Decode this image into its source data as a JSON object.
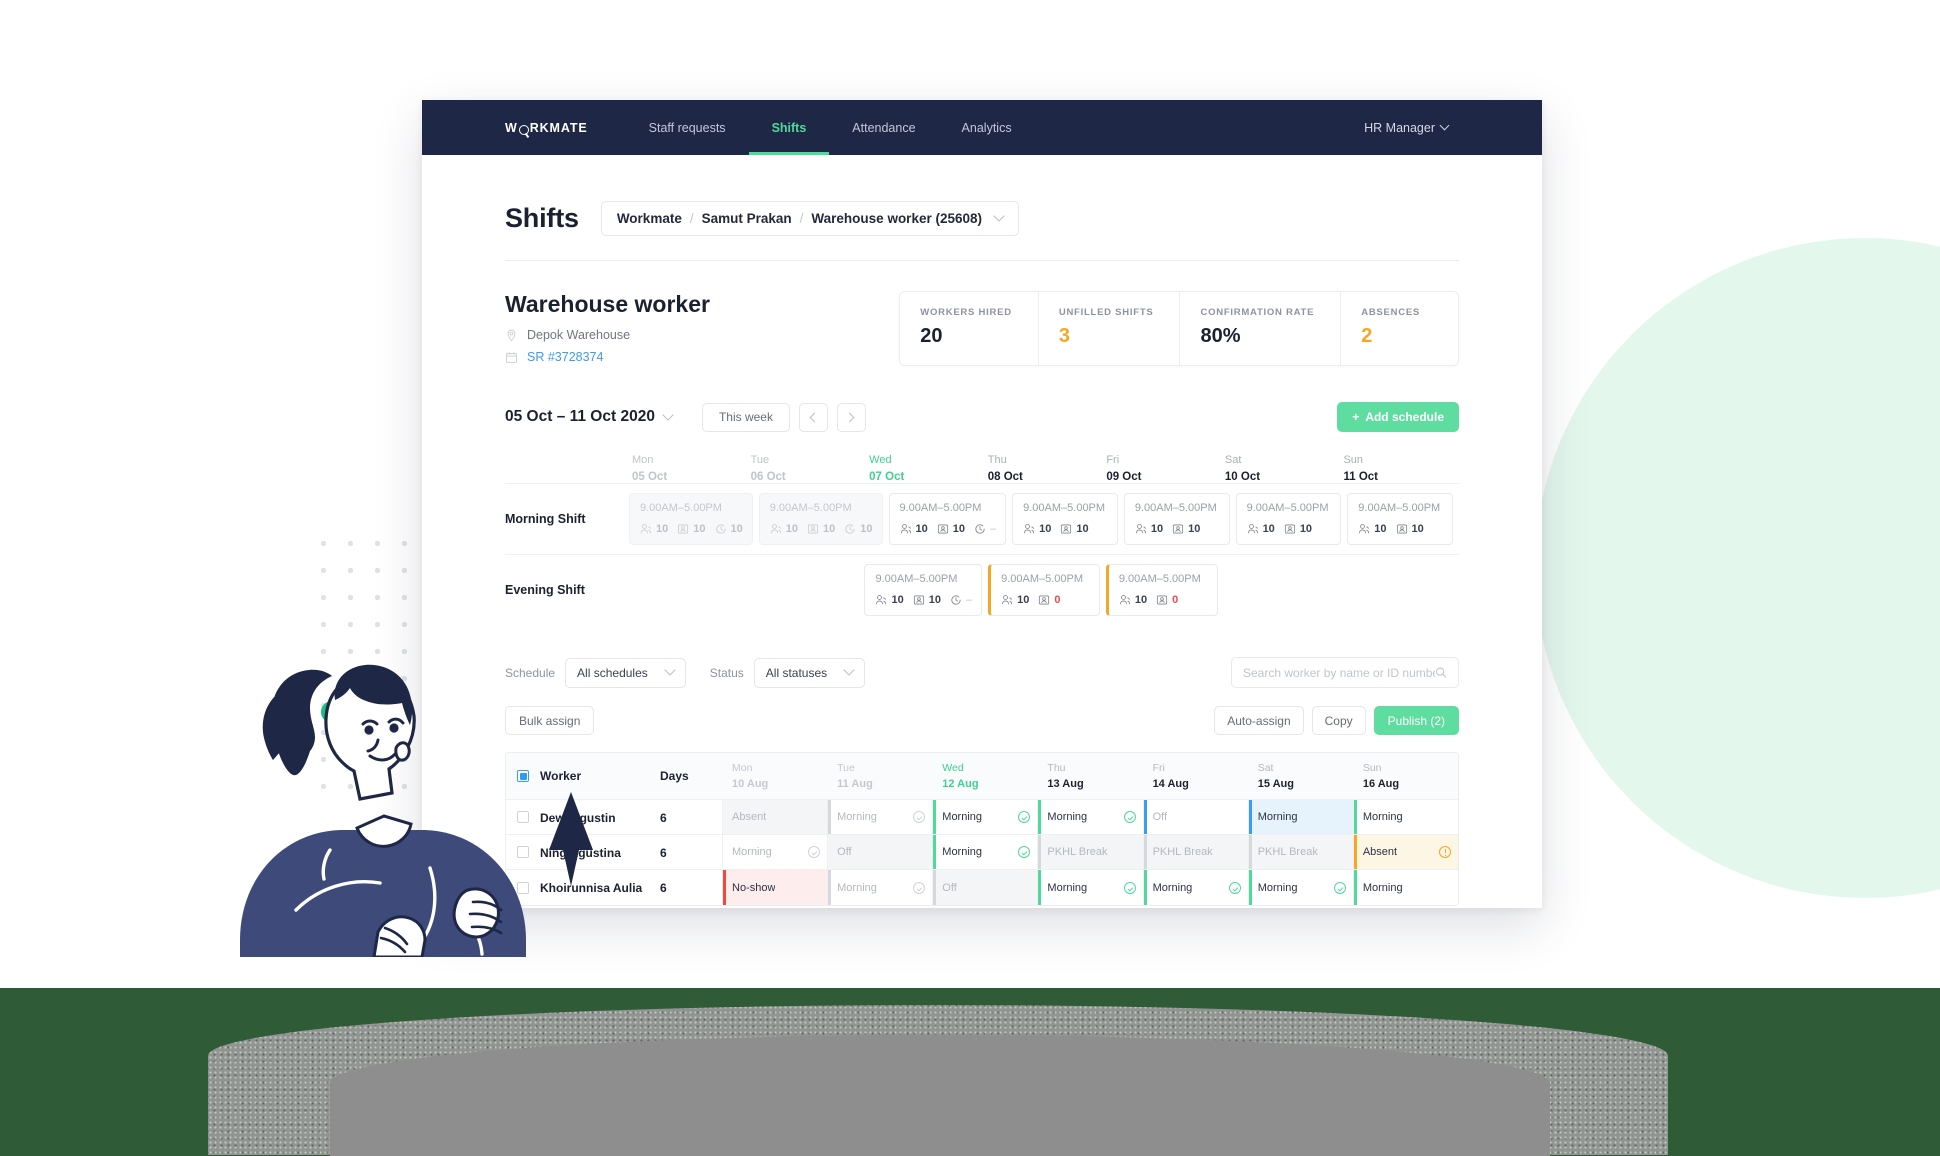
{
  "nav": {
    "brand": "WORKMATE",
    "items": [
      {
        "label": "Staff requests",
        "active": false
      },
      {
        "label": "Shifts",
        "active": true
      },
      {
        "label": "Attendance",
        "active": false
      },
      {
        "label": "Analytics",
        "active": false
      }
    ],
    "user": "HR Manager"
  },
  "header": {
    "title": "Shifts",
    "breadcrumb": [
      "Workmate",
      "Samut Prakan",
      "Warehouse worker (25608)"
    ]
  },
  "job": {
    "title": "Warehouse worker",
    "location": "Depok Warehouse",
    "sr_number": "SR #3728374"
  },
  "stats": [
    {
      "label": "WORKERS HIRED",
      "value": "20",
      "warn": false
    },
    {
      "label": "UNFILLED SHIFTS",
      "value": "3",
      "warn": true
    },
    {
      "label": "CONFIRMATION RATE",
      "value": "80%",
      "warn": false
    },
    {
      "label": "ABSENCES",
      "value": "2",
      "warn": true
    }
  ],
  "date_nav": {
    "range": "05 Oct – 11 Oct 2020",
    "this_week": "This week",
    "add_schedule": "Add schedule",
    "add_schedule_plus": "+"
  },
  "calendar": {
    "days": [
      {
        "dow": "Mon",
        "date": "05 Oct",
        "state": "muted"
      },
      {
        "dow": "Tue",
        "date": "06 Oct",
        "state": "muted"
      },
      {
        "dow": "Wed",
        "date": "07 Oct",
        "state": "today"
      },
      {
        "dow": "Thu",
        "date": "08 Oct",
        "state": "normal"
      },
      {
        "dow": "Fri",
        "date": "09 Oct",
        "state": "normal"
      },
      {
        "dow": "Sat",
        "date": "10 Oct",
        "state": "normal"
      },
      {
        "dow": "Sun",
        "date": "11 Oct",
        "state": "normal"
      }
    ],
    "rows": [
      {
        "label": "Morning Shift",
        "cells": [
          {
            "time": "9.00AM–5.00PM",
            "dim": true,
            "flagged": false,
            "hired": "10",
            "filled": "10",
            "confirmed": "10",
            "show_confirmed": true,
            "filled_red": false
          },
          {
            "time": "9.00AM–5.00PM",
            "dim": true,
            "flagged": false,
            "hired": "10",
            "filled": "10",
            "confirmed": "10",
            "show_confirmed": true,
            "filled_red": false
          },
          {
            "time": "9.00AM–5.00PM",
            "dim": false,
            "flagged": false,
            "hired": "10",
            "filled": "10",
            "confirmed": "–",
            "show_confirmed": true,
            "filled_red": false
          },
          {
            "time": "9.00AM–5.00PM",
            "dim": false,
            "flagged": false,
            "hired": "10",
            "filled": "10",
            "confirmed": "",
            "show_confirmed": false,
            "filled_red": false
          },
          {
            "time": "9.00AM–5.00PM",
            "dim": false,
            "flagged": false,
            "hired": "10",
            "filled": "10",
            "confirmed": "",
            "show_confirmed": false,
            "filled_red": false
          },
          {
            "time": "9.00AM–5.00PM",
            "dim": false,
            "flagged": false,
            "hired": "10",
            "filled": "10",
            "confirmed": "",
            "show_confirmed": false,
            "filled_red": false
          },
          {
            "time": "9.00AM–5.00PM",
            "dim": false,
            "flagged": false,
            "hired": "10",
            "filled": "10",
            "confirmed": "",
            "show_confirmed": false,
            "filled_red": false
          }
        ]
      },
      {
        "label": "Evening Shift",
        "cells": [
          {
            "empty": true
          },
          {
            "empty": true
          },
          {
            "time": "9.00AM–5.00PM",
            "dim": false,
            "flagged": false,
            "hired": "10",
            "filled": "10",
            "confirmed": "–",
            "show_confirmed": true,
            "filled_red": false
          },
          {
            "time": "9.00AM–5.00PM",
            "dim": false,
            "flagged": true,
            "hired": "10",
            "filled": "0",
            "confirmed": "",
            "show_confirmed": false,
            "filled_red": true
          },
          {
            "time": "9.00AM–5.00PM",
            "dim": false,
            "flagged": true,
            "hired": "10",
            "filled": "0",
            "confirmed": "",
            "show_confirmed": false,
            "filled_red": true
          },
          {
            "empty": true
          },
          {
            "empty": true
          }
        ]
      }
    ]
  },
  "filters": {
    "schedule_label": "Schedule",
    "schedule_value": "All schedules",
    "status_label": "Status",
    "status_value": "All statuses",
    "search_placeholder": "Search worker by name or ID number"
  },
  "actions": {
    "bulk_assign": "Bulk assign",
    "auto_assign": "Auto-assign",
    "copy": "Copy",
    "publish": "Publish (2)"
  },
  "worker_table": {
    "columns": {
      "worker": "Worker",
      "days": "Days"
    },
    "days": [
      {
        "dow": "Mon",
        "date": "10 Aug",
        "state": "muted"
      },
      {
        "dow": "Tue",
        "date": "11 Aug",
        "state": "muted"
      },
      {
        "dow": "Wed",
        "date": "12 Aug",
        "state": "today"
      },
      {
        "dow": "Thu",
        "date": "13 Aug",
        "state": "normal"
      },
      {
        "dow": "Fri",
        "date": "14 Aug",
        "state": "normal"
      },
      {
        "dow": "Sat",
        "date": "15 Aug",
        "state": "normal"
      },
      {
        "dow": "Sun",
        "date": "16 Aug",
        "state": "normal"
      }
    ],
    "rows": [
      {
        "name": "Dewi Agustin",
        "days": "6",
        "checked": false,
        "cells": [
          {
            "text": "Absent",
            "bar": "none",
            "bg": "bg-grey",
            "tone": "t-mute",
            "mark": "none"
          },
          {
            "text": "Morning",
            "bar": "grey",
            "bg": "bg-white",
            "tone": "t-mute",
            "mark": "tick-grey"
          },
          {
            "text": "Morning",
            "bar": "green",
            "bg": "bg-white",
            "tone": "t-dark",
            "mark": "tick-green"
          },
          {
            "text": "Morning",
            "bar": "green",
            "bg": "bg-white",
            "tone": "t-dark",
            "mark": "tick-green"
          },
          {
            "text": "Off",
            "bar": "blue",
            "bg": "bg-white",
            "tone": "t-mute",
            "mark": "none"
          },
          {
            "text": "Morning",
            "bar": "blue",
            "bg": "bg-blue",
            "tone": "t-dark",
            "mark": "none"
          },
          {
            "text": "Morning",
            "bar": "green",
            "bg": "bg-white",
            "tone": "t-dark",
            "mark": "none"
          }
        ]
      },
      {
        "name": "Ning Agustina",
        "days": "6",
        "checked": false,
        "cells": [
          {
            "text": "Morning",
            "bar": "none",
            "bg": "bg-white",
            "tone": "t-mute",
            "mark": "tick-grey"
          },
          {
            "text": "Off",
            "bar": "none",
            "bg": "bg-grey",
            "tone": "t-mute",
            "mark": "none"
          },
          {
            "text": "Morning",
            "bar": "green",
            "bg": "bg-white",
            "tone": "t-dark",
            "mark": "tick-green"
          },
          {
            "text": "PKHL Break",
            "bar": "grey",
            "bg": "bg-grey",
            "tone": "t-mute",
            "mark": "none"
          },
          {
            "text": "PKHL Break",
            "bar": "grey",
            "bg": "bg-grey",
            "tone": "t-mute",
            "mark": "none"
          },
          {
            "text": "PKHL Break",
            "bar": "grey",
            "bg": "bg-grey",
            "tone": "t-mute",
            "mark": "none"
          },
          {
            "text": "Absent",
            "bar": "orange",
            "bg": "bg-yellow",
            "tone": "t-dark",
            "mark": "bang"
          }
        ]
      },
      {
        "name": "Khoirunnisa Aulia",
        "days": "6",
        "checked": false,
        "cells": [
          {
            "text": "No-show",
            "bar": "red",
            "bg": "bg-red",
            "tone": "t-dark",
            "mark": "none"
          },
          {
            "text": "Morning",
            "bar": "grey",
            "bg": "bg-white",
            "tone": "t-mute",
            "mark": "tick-grey"
          },
          {
            "text": "Off",
            "bar": "grey",
            "bg": "bg-grey",
            "tone": "t-mute",
            "mark": "none"
          },
          {
            "text": "Morning",
            "bar": "green",
            "bg": "bg-white",
            "tone": "t-dark",
            "mark": "tick-green"
          },
          {
            "text": "Morning",
            "bar": "green",
            "bg": "bg-white",
            "tone": "t-dark",
            "mark": "tick-green"
          },
          {
            "text": "Morning",
            "bar": "green",
            "bg": "bg-white",
            "tone": "t-dark",
            "mark": "tick-green"
          },
          {
            "text": "Morning",
            "bar": "green",
            "bg": "bg-white",
            "tone": "t-dark",
            "mark": "none"
          }
        ]
      }
    ]
  },
  "colors": {
    "nav_bg": "#1e2745",
    "accent_green": "#4fd99a",
    "button_green": "#5fdca0",
    "warn_orange": "#f5a623",
    "danger_red": "#f5453f",
    "link_blue": "#3d9bf0",
    "band_green": "#2f5b36",
    "mint": "#e4f7ed"
  }
}
